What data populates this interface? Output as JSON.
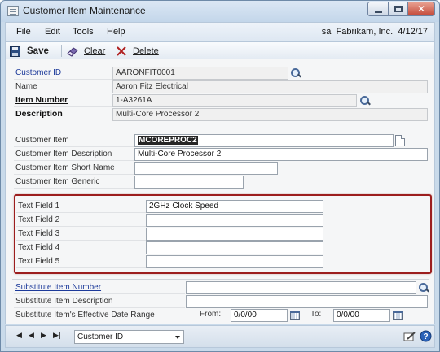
{
  "window": {
    "title": "Customer Item Maintenance",
    "close_glyph": "✕"
  },
  "menu": {
    "items": [
      "File",
      "Edit",
      "Tools",
      "Help"
    ],
    "user": "sa",
    "company": "Fabrikam, Inc.",
    "date": "4/12/17"
  },
  "toolbar": {
    "save_label": "Save",
    "clear_label": "Clear",
    "delete_label": "Delete"
  },
  "form": {
    "customer_id": {
      "label": "Customer ID",
      "value": "AARONFIT0001"
    },
    "name": {
      "label": "Name",
      "value": "Aaron Fitz Electrical"
    },
    "item_number": {
      "label": "Item Number",
      "value": "1-A3261A"
    },
    "description": {
      "label": "Description",
      "value": "Multi-Core Processor 2"
    },
    "customer_item": {
      "label": "Customer Item",
      "value": "MCOREPROC2"
    },
    "customer_item_description": {
      "label": "Customer Item Description",
      "value": "Multi-Core Processor 2"
    },
    "customer_item_short_name": {
      "label": "Customer Item Short Name",
      "value": ""
    },
    "customer_item_generic": {
      "label": "Customer Item Generic",
      "value": ""
    },
    "text_fields": [
      {
        "label": "Text Field 1",
        "value": "2GHz Clock Speed"
      },
      {
        "label": "Text Field 2",
        "value": ""
      },
      {
        "label": "Text Field 3",
        "value": ""
      },
      {
        "label": "Text Field 4",
        "value": ""
      },
      {
        "label": "Text Field 5",
        "value": ""
      }
    ],
    "substitute_item_number": {
      "label": "Substitute Item Number",
      "value": ""
    },
    "substitute_item_description": {
      "label": "Substitute Item Description",
      "value": ""
    },
    "effective_range": {
      "label": "Substitute Item's Effective Date Range",
      "from_label": "From:",
      "from_value": "0/0/00",
      "to_label": "To:",
      "to_value": "0/0/00"
    }
  },
  "bottom": {
    "nav": {
      "first": "|◀",
      "prev": "◀",
      "next": "▶",
      "last": "▶|"
    },
    "sort_by": "Customer ID"
  },
  "colors": {
    "highlight_box": "#9c1e1e",
    "link": "#1c3a9a"
  }
}
